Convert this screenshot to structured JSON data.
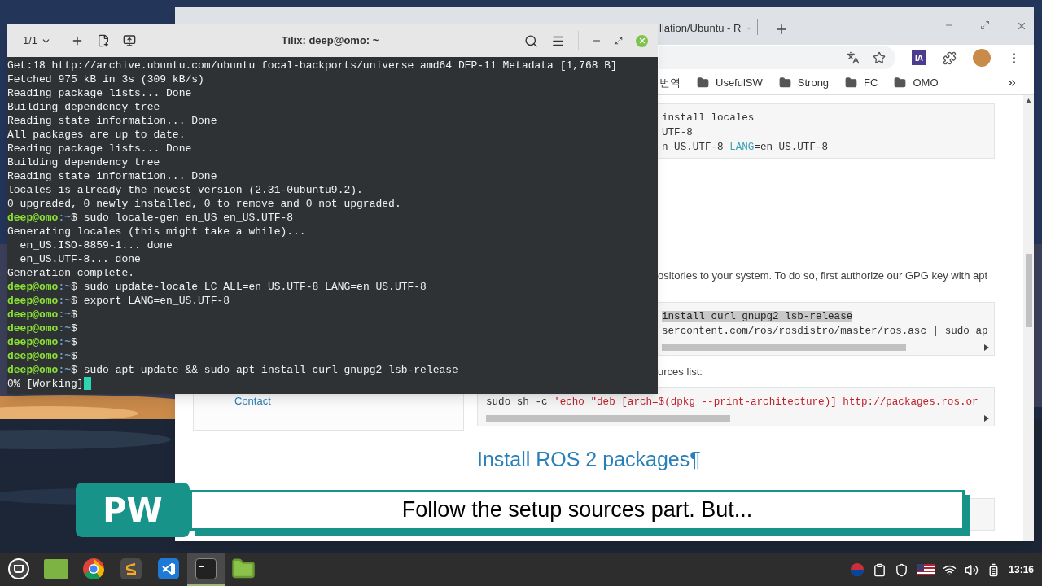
{
  "terminal": {
    "session": "1/1",
    "title": "Tilix: deep@omo: ~",
    "lines": [
      {
        "kind": "output",
        "text": "Get:18 http://archive.ubuntu.com/ubuntu focal-backports/universe amd64 DEP-11 Metadata [1,768 B]"
      },
      {
        "kind": "output",
        "text": "Fetched 975 kB in 3s (309 kB/s)"
      },
      {
        "kind": "output",
        "text": "Reading package lists... Done"
      },
      {
        "kind": "output",
        "text": "Building dependency tree"
      },
      {
        "kind": "output",
        "text": "Reading state information... Done"
      },
      {
        "kind": "output",
        "text": "All packages are up to date."
      },
      {
        "kind": "output",
        "text": "Reading package lists... Done"
      },
      {
        "kind": "output",
        "text": "Building dependency tree"
      },
      {
        "kind": "output",
        "text": "Reading state information... Done"
      },
      {
        "kind": "output",
        "text": "locales is already the newest version (2.31-0ubuntu9.2)."
      },
      {
        "kind": "output",
        "text": "0 upgraded, 0 newly installed, 0 to remove and 0 not upgraded."
      },
      {
        "kind": "prompt",
        "user": "deep@omo",
        "cwd": ":~",
        "symbol": "$",
        "command": "sudo locale-gen en_US en_US.UTF-8"
      },
      {
        "kind": "output",
        "text": "Generating locales (this might take a while)..."
      },
      {
        "kind": "output",
        "text": "  en_US.ISO-8859-1... done"
      },
      {
        "kind": "output",
        "text": "  en_US.UTF-8... done"
      },
      {
        "kind": "output",
        "text": "Generation complete."
      },
      {
        "kind": "prompt",
        "user": "deep@omo",
        "cwd": ":~",
        "symbol": "$",
        "command": "sudo update-locale LC_ALL=en_US.UTF-8 LANG=en_US.UTF-8"
      },
      {
        "kind": "prompt",
        "user": "deep@omo",
        "cwd": ":~",
        "symbol": "$",
        "command": "export LANG=en_US.UTF-8"
      },
      {
        "kind": "prompt",
        "user": "deep@omo",
        "cwd": ":~",
        "symbol": "$"
      },
      {
        "kind": "prompt",
        "user": "deep@omo",
        "cwd": ":~",
        "symbol": "$"
      },
      {
        "kind": "prompt",
        "user": "deep@omo",
        "cwd": ":~",
        "symbol": "$"
      },
      {
        "kind": "prompt",
        "user": "deep@omo",
        "cwd": ":~",
        "symbol": "$"
      },
      {
        "kind": "prompt",
        "user": "deep@omo",
        "cwd": ":~",
        "symbol": "$",
        "command": "sudo apt update && sudo apt install curl gnupg2 lsb-release"
      },
      {
        "kind": "output",
        "text": "0% [Working]",
        "cursor": true
      }
    ]
  },
  "browser": {
    "tab": {
      "title": "llation/Ubuntu - R"
    },
    "bookmarks": [
      {
        "kind": "link",
        "label": "번역"
      },
      {
        "kind": "folder",
        "label": "UsefulSW"
      },
      {
        "kind": "folder",
        "label": "Strong"
      },
      {
        "kind": "folder",
        "label": "FC"
      },
      {
        "kind": "folder",
        "label": "OMO"
      }
    ],
    "extension": "IA",
    "sidebar": {
      "link": "Contact"
    },
    "blocks": [
      {
        "kind": "code",
        "indented": true,
        "lines": [
          [
            {
              "kind": "plain",
              "text": "install locales"
            }
          ],
          [
            {
              "kind": "plain",
              "text": "UTF-8"
            }
          ],
          [
            {
              "kind": "plain",
              "text": "n_US.UTF-8 "
            },
            {
              "kind": "keyword",
              "text": "LANG"
            },
            {
              "kind": "plain",
              "text": "=en_US.UTF-8"
            }
          ]
        ]
      },
      {
        "kind": "text",
        "text": "ositories to your system. To do so, first authorize our GPG key with apt"
      },
      {
        "kind": "code",
        "indented": true,
        "scroll": true,
        "lines": [
          [
            {
              "kind": "selected",
              "text": "install curl gnupg2 lsb-release"
            }
          ],
          [
            {
              "kind": "plain",
              "text": "sercontent.com/ros/rosdistro/master/ros.asc | sudo ap"
            }
          ]
        ]
      },
      {
        "kind": "text",
        "text": "urces list:"
      },
      {
        "kind": "code",
        "indented": false,
        "scroll": true,
        "lines": [
          [
            {
              "kind": "plain",
              "text": "sudo sh -c "
            },
            {
              "kind": "string",
              "text": "'echo \"deb [arch=$(dpkg --print-architecture)] http://packages.ros.or"
            }
          ]
        ]
      },
      {
        "kind": "heading",
        "text": "Install ROS 2 packages¶"
      }
    ]
  },
  "caption": {
    "badge": "PW",
    "text": "Follow the setup sources part. But..."
  },
  "taskbar": {
    "apps": [
      {
        "kind": "mint",
        "selected": false
      },
      {
        "kind": "desktop",
        "selected": false
      },
      {
        "kind": "chrome",
        "selected": false
      },
      {
        "kind": "sublime",
        "selected": false
      },
      {
        "kind": "vscode",
        "selected": false
      },
      {
        "kind": "terminal",
        "selected": true
      },
      {
        "kind": "files",
        "selected": false
      }
    ],
    "clock": "13:16"
  }
}
